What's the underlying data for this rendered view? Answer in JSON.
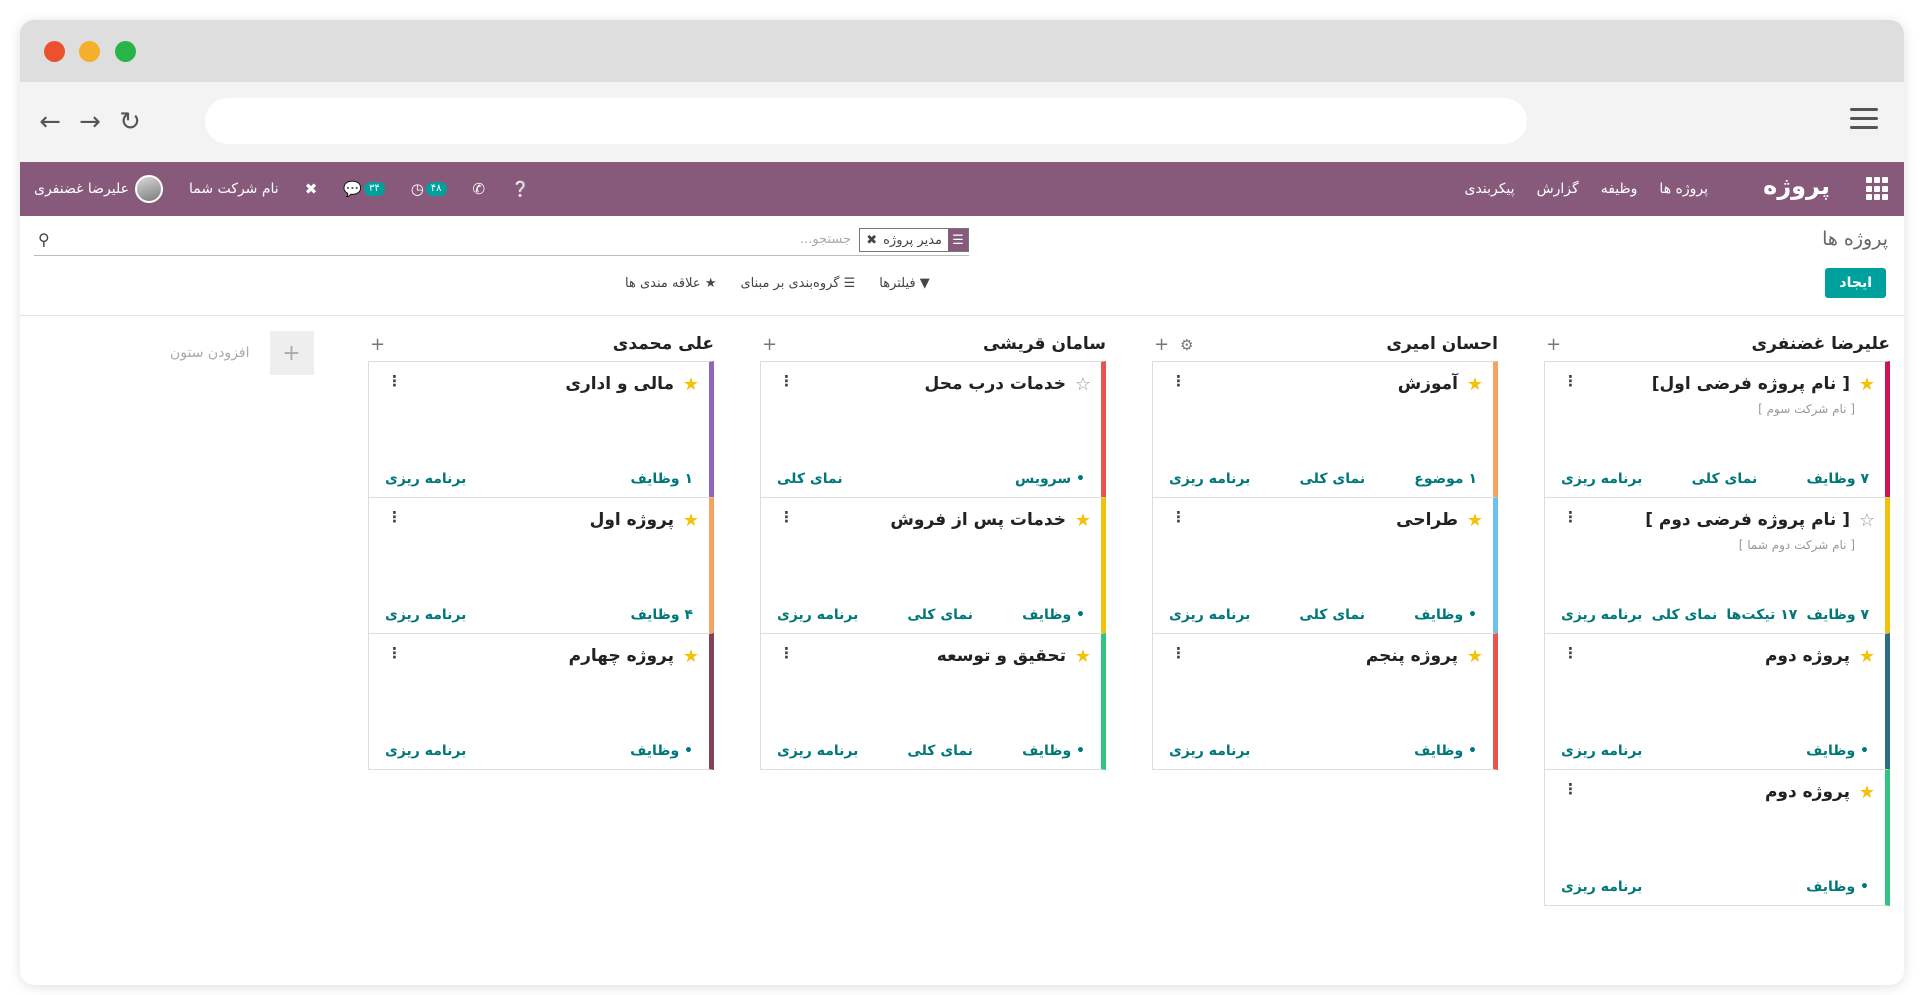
{
  "topbar": {
    "brand": "پروژه",
    "menu": [
      "پروژه ها",
      "وظیفه",
      "گزارش",
      "پیکربندی"
    ],
    "user_name": "علیرضا غضنفری",
    "company": "نام شرکت شما",
    "messages_count": "۳۴",
    "activities_count": "۴۸"
  },
  "control_panel": {
    "breadcrumb": "پروژه ها",
    "create_label": "ایجاد",
    "search_facet": "مدیر پروژه",
    "search_placeholder": "جستجو...",
    "filters_label": "فیلترها",
    "groupby_label": "گروه‌بندی بر مبنای",
    "favorites_label": "علاقه مندی ها"
  },
  "kanban": {
    "add_column_label": "افزودن ستون",
    "columns": [
      {
        "title": "علیرضا غضنفری",
        "cards": [
          {
            "name": "[ نام پروژه فرضی اول]",
            "sub": "[ نام شرکت سوم ]",
            "starred": true,
            "color": "#d0145a",
            "links": [
              "۷ وظایف",
              "نمای کلی",
              "برنامه ریزی"
            ]
          },
          {
            "name": "[ نام پروژه فرضی دوم ]",
            "sub": "[ نام شرکت دوم شما ]",
            "starred": false,
            "color": "#f3c00b",
            "links": [
              "۷ وظایف",
              "۱۷ تیکت‌ها",
              "نمای کلی",
              "برنامه ریزی"
            ]
          },
          {
            "name": "پروژه دوم",
            "sub": "",
            "starred": true,
            "color": "#2c6c85",
            "links": [
              "• وظایف",
              "برنامه ریزی"
            ]
          },
          {
            "name": "پروژه دوم",
            "sub": "",
            "starred": true,
            "color": "#30c381",
            "links": [
              "• وظایف",
              "برنامه ریزی"
            ]
          }
        ]
      },
      {
        "title": "احسان امیری",
        "cards": [
          {
            "name": "آموزش",
            "sub": "",
            "starred": true,
            "color": "#f4a460",
            "links": [
              "۱ موضوع",
              "نمای کلی",
              "برنامه ریزی"
            ]
          },
          {
            "name": "طراحی",
            "sub": "",
            "starred": true,
            "color": "#6cc1ed",
            "links": [
              "• وظایف",
              "نمای کلی",
              "برنامه ریزی"
            ]
          },
          {
            "name": "پروژه پنجم",
            "sub": "",
            "starred": true,
            "color": "#e8554e",
            "links": [
              "• وظایف",
              "برنامه ریزی"
            ]
          }
        ]
      },
      {
        "title": "سامان قریشی",
        "cards": [
          {
            "name": "خدمات درب محل",
            "sub": "",
            "starred": false,
            "color": "#e8554e",
            "links": [
              "• سرویس",
              "نمای کلی"
            ]
          },
          {
            "name": "خدمات پس از فروش",
            "sub": "",
            "starred": true,
            "color": "#f3c00b",
            "links": [
              "• وظایف",
              "نمای کلی",
              "برنامه ریزی"
            ]
          },
          {
            "name": "تحقیق و توسعه",
            "sub": "",
            "starred": true,
            "color": "#30c381",
            "links": [
              "• وظایف",
              "نمای کلی",
              "برنامه ریزی"
            ]
          }
        ]
      },
      {
        "title": "علی محمدی",
        "cards": [
          {
            "name": "مالی و اداری",
            "sub": "",
            "starred": true,
            "color": "#9365b8",
            "links": [
              "۱ وظایف",
              "برنامه ریزی"
            ]
          },
          {
            "name": "پروژه اول",
            "sub": "",
            "starred": true,
            "color": "#f4a460",
            "links": [
              "۴ وظایف",
              "برنامه ریزی"
            ]
          },
          {
            "name": "پروژه چهارم",
            "sub": "",
            "starred": true,
            "color": "#804259",
            "links": [
              "• وظایف",
              "برنامه ریزی"
            ]
          }
        ]
      }
    ]
  }
}
